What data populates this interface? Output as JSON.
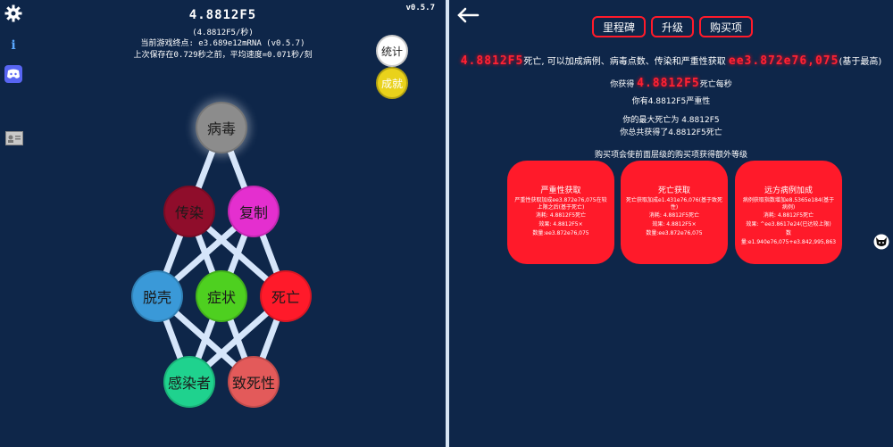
{
  "left": {
    "amount": "4.8812F5",
    "rate": "(4.8812F5/秒)",
    "endgame": "当前游戏终点: e3.689e12mRNA (v0.5.7)",
    "save": "上次保存在0.729秒之前，平均速度=0.071秒/刻",
    "version": "v0.5.7",
    "buttons": {
      "stats": "统计",
      "achievements": "成就"
    },
    "icons": [
      "gear-icon",
      "info-icon",
      "discord-icon",
      "id-card-icon"
    ],
    "info_glyph": "i",
    "nodes": [
      {
        "id": "virus",
        "label": "病毒",
        "color": "#8c8c8c"
      },
      {
        "id": "infect",
        "label": "传染",
        "color": "#8f0d2b"
      },
      {
        "id": "replicate",
        "label": "复制",
        "color": "#e42fcf"
      },
      {
        "id": "shed",
        "label": "脱壳",
        "color": "#3a99d8"
      },
      {
        "id": "symptom",
        "label": "症状",
        "color": "#4ed020"
      },
      {
        "id": "death",
        "label": "死亡",
        "color": "#ff1a2a"
      },
      {
        "id": "infected",
        "label": "感染者",
        "color": "#1fd28e"
      },
      {
        "id": "lethality",
        "label": "致死性",
        "color": "#e35a5a"
      }
    ]
  },
  "right": {
    "tabs": [
      "里程碑",
      "升级",
      "购买项"
    ],
    "headline": {
      "amount": "4.8812F5",
      "text1": "死亡, 可以加成病例、病毒点数、传染和严重性获取",
      "bonus": "ee3.872e76,075",
      "text2": "(基于最高)"
    },
    "gain": {
      "prefix": "你获得",
      "amount": "4.8812F5",
      "suffix": "死亡每秒"
    },
    "severity": "你有4.8812F5严重性",
    "max_death": "你的最大死亡为 4.8812F5",
    "total_death": "你总共获得了4.8812F5死亡",
    "note": "购买项会使前面层级的购买项获得额外等级",
    "cards": [
      {
        "title": "严重性获取",
        "desc": "严重性获取加成ee3.872e76,075在较上限之后(基于死亡)",
        "cost": "消耗: 4.8812F5死亡",
        "effect": "效果: 4.8812F5×",
        "amount": "数量:ee3.872e76,075"
      },
      {
        "title": "死亡获取",
        "desc": "死亡获取加成e1.431e76,076(基于致死性)",
        "cost": "消耗: 4.8812F5死亡",
        "effect": "效果: 4.8812F5×",
        "amount": "数量:ee3.872e76,075"
      },
      {
        "title": "远方病例加成",
        "desc": "病例获取指数增加e8.5365e184(基于病例)",
        "cost": "消耗: 4.8812F5死亡",
        "effect": "效果: ^ee3.8617e24(已达较上限)",
        "amount": "数量:e1.940e76,075+e3.842,995,863"
      }
    ],
    "icons": [
      "back-arrow-icon",
      "avatar-icon"
    ]
  },
  "colors": {
    "background": "#0e2649",
    "accent_red": "#ff1a2a",
    "line": "#d5e5fa"
  }
}
